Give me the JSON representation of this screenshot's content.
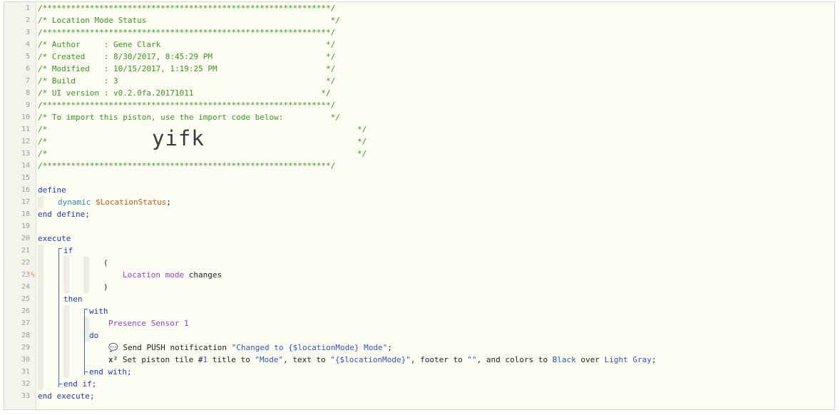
{
  "header": {
    "stars": "/*************************************************************/",
    "title": "/* Location Mode Status                                       */",
    "author": "/* Author     : Gene Clark                                   */",
    "created": "/* Created    : 8/30/2017, 8:45:29 PM                        */",
    "modified": "/* Modified   : 10/15/2017, 1:19:25 PM                       */",
    "build": "/* Build      : 3                                            */",
    "ui_version": "/* UI version : v0.2.0fa.20171011                           */",
    "import_note": "/* To import this piston, use the import code below:          */",
    "blank_open": "/*",
    "blank_close": "*/",
    "import_code": "yifk"
  },
  "code": {
    "define": "define",
    "dynamic": "dynamic",
    "var_name": "$LocationStatus",
    "semicolon": ";",
    "end_define": "end define;",
    "execute": "execute",
    "if": "if",
    "open_paren": "(",
    "condition_subject": "Location mode",
    "condition_op": "changes",
    "close_paren": ")",
    "then": "then",
    "with": "with",
    "device": "Presence Sensor 1",
    "do": "do",
    "push_icon": "💬",
    "push_prefix": "Send PUSH notification ",
    "push_message": "\"Changed to {$locationMode} Mode\"",
    "push_suffix": ";",
    "tile_icon": "x²",
    "tile_text_1": "Set piston tile #",
    "tile_num": "1",
    "tile_text_2": " title to ",
    "tile_title": "\"Mode\"",
    "tile_text_3": ", text to ",
    "tile_text_val": "\"{$locationMode}\"",
    "tile_text_4": ", footer to ",
    "tile_footer": "\"\"",
    "tile_text_5": ", and colors to ",
    "tile_fg": "Black",
    "tile_text_6": " over ",
    "tile_bg": "Light Gray",
    "tile_text_7": ";",
    "end_with": "end with;",
    "end_if": "end if;",
    "end_execute": "end execute;"
  },
  "line_numbers": [
    "1",
    "2",
    "3",
    "4",
    "5",
    "6",
    "7",
    "8",
    "9",
    "10",
    "11",
    "12",
    "13",
    "14",
    "15",
    "16",
    "17",
    "18",
    "19",
    "20",
    "21",
    "22",
    "23",
    "24",
    "25",
    "26",
    "27",
    "28",
    "29",
    "30",
    "31",
    "32",
    "33"
  ],
  "colors": {
    "comment": "#339b1b",
    "keyword": "#1c3ab3",
    "variable": "#c75b17",
    "device": "#9d3ec7",
    "string": "#2f53c4"
  },
  "icons": {
    "trigger_marker": "lightning-bolt-icon"
  },
  "trigger_marker_glyph": "ϟ"
}
